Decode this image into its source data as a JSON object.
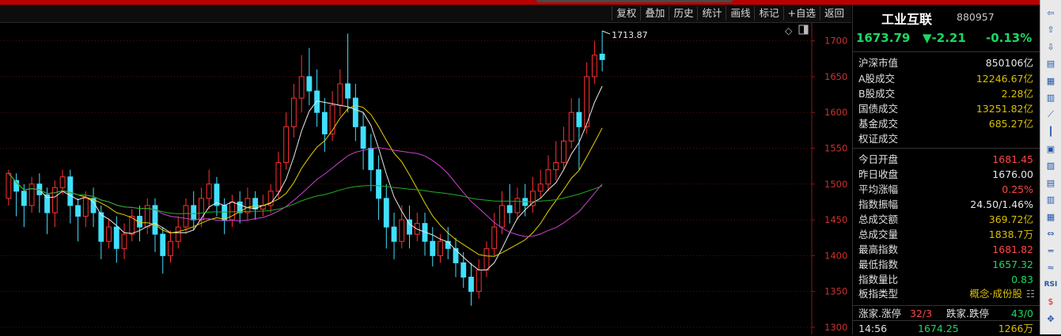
{
  "toolbar": {
    "buttons": [
      "复权",
      "叠加",
      "历史",
      "统计",
      "画线",
      "标记",
      "+自选",
      "返回"
    ]
  },
  "chart_data": {
    "type": "candlestick",
    "y_ticks": [
      1300,
      1350,
      1400,
      1450,
      1500,
      1550,
      1600,
      1650,
      1700
    ],
    "ylim": [
      1290,
      1725
    ],
    "high_label": "1713.87",
    "ma_colors": {
      "ma5": "#e8e8e8",
      "ma10": "#e6d200",
      "ma20": "#d040d0",
      "ma60": "#20b020"
    },
    "up_color": "#ff3030",
    "down_color": "#40e0ff",
    "candles": [
      [
        1480,
        1515,
        1470,
        1520
      ],
      [
        1505,
        1490,
        1455,
        1515
      ],
      [
        1490,
        1470,
        1440,
        1500
      ],
      [
        1470,
        1500,
        1460,
        1510
      ],
      [
        1500,
        1485,
        1460,
        1515
      ],
      [
        1485,
        1460,
        1430,
        1495
      ],
      [
        1460,
        1495,
        1440,
        1505
      ],
      [
        1495,
        1510,
        1485,
        1520
      ],
      [
        1510,
        1470,
        1445,
        1520
      ],
      [
        1470,
        1455,
        1420,
        1480
      ],
      [
        1455,
        1480,
        1440,
        1490
      ],
      [
        1480,
        1460,
        1440,
        1495
      ],
      [
        1460,
        1420,
        1395,
        1470
      ],
      [
        1420,
        1440,
        1410,
        1450
      ],
      [
        1440,
        1410,
        1390,
        1455
      ],
      [
        1410,
        1430,
        1395,
        1445
      ],
      [
        1430,
        1455,
        1420,
        1465
      ],
      [
        1455,
        1440,
        1420,
        1470
      ],
      [
        1440,
        1470,
        1430,
        1480
      ],
      [
        1470,
        1430,
        1405,
        1480
      ],
      [
        1430,
        1400,
        1375,
        1440
      ],
      [
        1400,
        1420,
        1390,
        1435
      ],
      [
        1420,
        1440,
        1410,
        1455
      ],
      [
        1440,
        1470,
        1430,
        1480
      ],
      [
        1470,
        1450,
        1435,
        1490
      ],
      [
        1450,
        1480,
        1440,
        1495
      ],
      [
        1480,
        1500,
        1465,
        1520
      ],
      [
        1500,
        1470,
        1455,
        1510
      ],
      [
        1470,
        1450,
        1430,
        1480
      ],
      [
        1450,
        1475,
        1440,
        1485
      ],
      [
        1475,
        1460,
        1445,
        1490
      ],
      [
        1460,
        1480,
        1450,
        1495
      ],
      [
        1480,
        1465,
        1450,
        1490
      ],
      [
        1465,
        1470,
        1455,
        1485
      ],
      [
        1470,
        1490,
        1460,
        1500
      ],
      [
        1490,
        1530,
        1480,
        1545
      ],
      [
        1530,
        1580,
        1520,
        1600
      ],
      [
        1580,
        1620,
        1565,
        1640
      ],
      [
        1620,
        1650,
        1600,
        1680
      ],
      [
        1650,
        1630,
        1610,
        1690
      ],
      [
        1630,
        1600,
        1580,
        1660
      ],
      [
        1600,
        1570,
        1545,
        1620
      ],
      [
        1570,
        1610,
        1560,
        1630
      ],
      [
        1610,
        1640,
        1595,
        1660
      ],
      [
        1640,
        1620,
        1600,
        1710
      ],
      [
        1620,
        1580,
        1560,
        1640
      ],
      [
        1580,
        1550,
        1520,
        1600
      ],
      [
        1550,
        1520,
        1490,
        1570
      ],
      [
        1520,
        1480,
        1450,
        1540
      ],
      [
        1480,
        1440,
        1410,
        1500
      ],
      [
        1440,
        1420,
        1395,
        1460
      ],
      [
        1420,
        1450,
        1410,
        1470
      ],
      [
        1450,
        1430,
        1410,
        1470
      ],
      [
        1430,
        1445,
        1420,
        1460
      ],
      [
        1445,
        1420,
        1400,
        1460
      ],
      [
        1420,
        1400,
        1385,
        1440
      ],
      [
        1400,
        1420,
        1390,
        1430
      ],
      [
        1420,
        1410,
        1395,
        1440
      ],
      [
        1410,
        1390,
        1370,
        1425
      ],
      [
        1390,
        1370,
        1355,
        1405
      ],
      [
        1370,
        1350,
        1330,
        1390
      ],
      [
        1350,
        1380,
        1340,
        1395
      ],
      [
        1380,
        1410,
        1370,
        1420
      ],
      [
        1410,
        1440,
        1400,
        1460
      ],
      [
        1440,
        1470,
        1430,
        1490
      ],
      [
        1470,
        1460,
        1445,
        1500
      ],
      [
        1460,
        1480,
        1450,
        1495
      ],
      [
        1480,
        1470,
        1455,
        1500
      ],
      [
        1470,
        1490,
        1460,
        1510
      ],
      [
        1490,
        1500,
        1480,
        1520
      ],
      [
        1500,
        1520,
        1490,
        1540
      ],
      [
        1520,
        1530,
        1505,
        1560
      ],
      [
        1530,
        1560,
        1520,
        1580
      ],
      [
        1560,
        1600,
        1550,
        1620
      ],
      [
        1600,
        1580,
        1520,
        1620
      ],
      [
        1580,
        1650,
        1570,
        1670
      ],
      [
        1650,
        1680,
        1640,
        1700
      ],
      [
        1681.45,
        1673.79,
        1657.32,
        1713.87
      ]
    ]
  },
  "panel": {
    "title": "工业互联",
    "code": "880957",
    "price": "1673.79",
    "change": "▼-2.21",
    "change_pct": "-0.13%",
    "rows": [
      {
        "label": "沪深市值",
        "value": "850106亿",
        "color": "wht"
      },
      {
        "label": "A股成交",
        "value": "12246.67亿",
        "color": "yel"
      },
      {
        "label": "B股成交",
        "value": "2.28亿",
        "color": "yel"
      },
      {
        "label": "国债成交",
        "value": "13251.82亿",
        "color": "yel"
      },
      {
        "label": "基金成交",
        "value": "685.27亿",
        "color": "yel"
      },
      {
        "label": "权证成交",
        "value": "",
        "color": "yel"
      },
      {
        "label": "今日开盘",
        "value": "1681.45",
        "color": "red"
      },
      {
        "label": "昨日收盘",
        "value": "1676.00",
        "color": "wht"
      },
      {
        "label": "平均涨幅",
        "value": "0.25%",
        "color": "red"
      },
      {
        "label": "指数振幅",
        "value": "24.50/1.46%",
        "color": "wht"
      },
      {
        "label": "总成交额",
        "value": "369.72亿",
        "color": "yel"
      },
      {
        "label": "总成交量",
        "value": "1838.7万",
        "color": "yel"
      },
      {
        "label": "最高指数",
        "value": "1681.82",
        "color": "red"
      },
      {
        "label": "最低指数",
        "value": "1657.32",
        "color": "grn"
      },
      {
        "label": "指数量比",
        "value": "0.83",
        "color": "grn"
      }
    ],
    "type_label": "板指类型",
    "type_value": "概念·成份股",
    "updown": {
      "up_label": "涨家.涨停",
      "up_value": "32/3",
      "down_label": "跌家.跌停",
      "down_value": "43/0"
    },
    "tick": {
      "time": "14:56",
      "price": "1674.25",
      "volume": "1266万"
    }
  },
  "sidebar": {
    "icons": [
      "back-arrow-icon",
      "up-arrow-icon",
      "down-arrow-icon",
      "f10-icon",
      "list-icon",
      "grid-icon",
      "line-chart-icon",
      "candle-icon",
      "table-icon",
      "finance-icon",
      "doc-icon",
      "f10-alt-icon",
      "f2-icon",
      "compare-icon",
      "divider-icon",
      "wave-icon",
      "rsi-icon",
      "money-icon",
      "expand-icon"
    ]
  }
}
